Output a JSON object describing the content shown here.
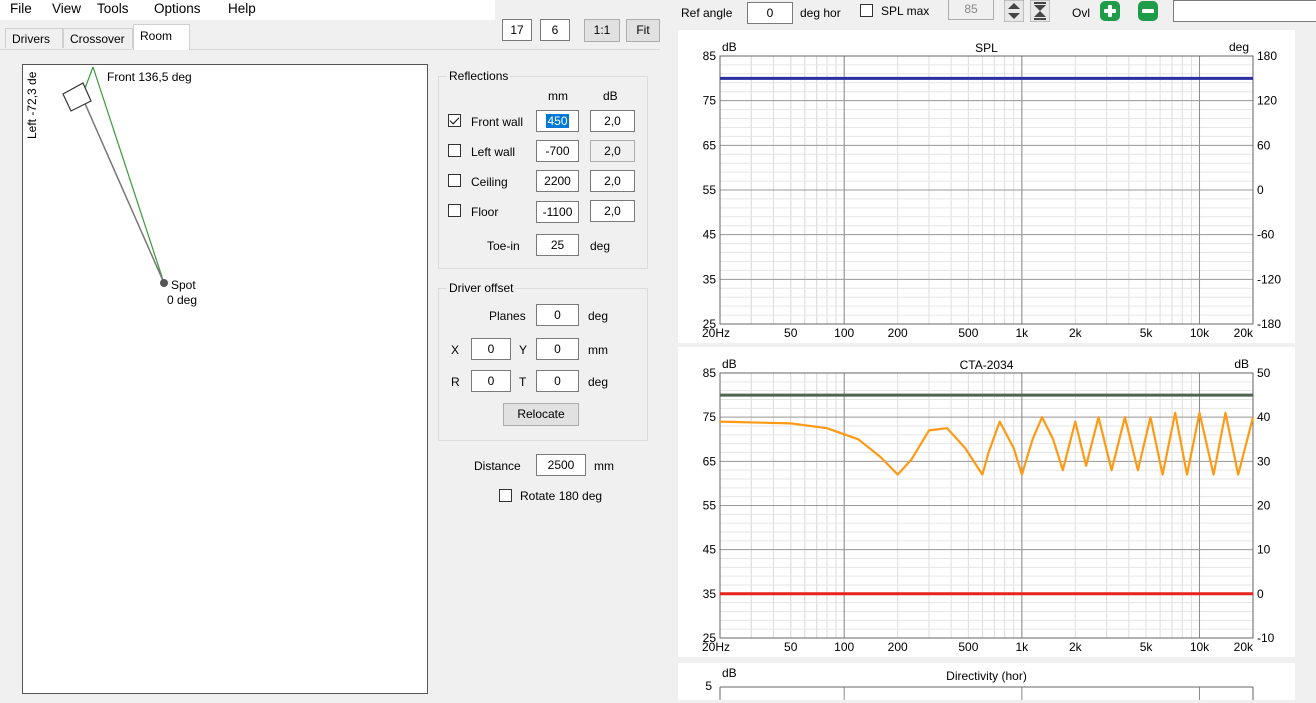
{
  "menu": [
    "File",
    "View",
    "Tools",
    "Options",
    "Help"
  ],
  "toolbar": {
    "num_a": "17",
    "num_b": "6",
    "ratio_label": "1:1",
    "fit_label": "Fit",
    "ref_angle_label": "Ref angle",
    "ref_angle_value": "0",
    "deg_hor_label": "deg hor",
    "spl_max_label": "SPL max",
    "spl_max_value": "85",
    "ovl_label": "Ovl",
    "search_value": ""
  },
  "tabs": {
    "drivers": "Drivers",
    "crossover": "Crossover",
    "room": "Room",
    "active": "room"
  },
  "room": {
    "front_label": "Front 136,5 deg",
    "left_label": "Left -72,3 de",
    "spot_label": "Spot",
    "spot_deg": "0 deg"
  },
  "reflections": {
    "title": "Reflections",
    "col_mm": "mm",
    "col_db": "dB",
    "rows": [
      {
        "label": "Front wall",
        "checked": true,
        "mm": "450",
        "db": "2,0"
      },
      {
        "label": "Left wall",
        "checked": false,
        "mm": "-700",
        "db": "2,0"
      },
      {
        "label": "Ceiling",
        "checked": false,
        "mm": "2200",
        "db": "2,0"
      },
      {
        "label": "Floor",
        "checked": false,
        "mm": "-1100",
        "db": "2,0"
      }
    ],
    "toe_in_label": "Toe-in",
    "toe_in_value": "25",
    "toe_in_unit": "deg"
  },
  "driver_offset": {
    "title": "Driver offset",
    "planes_label": "Planes",
    "planes_value": "0",
    "deg": "deg",
    "x_label": "X",
    "x_value": "0",
    "y_label": "Y",
    "y_value": "0",
    "mm": "mm",
    "r_label": "R",
    "r_value": "0",
    "t_label": "T",
    "t_value": "0",
    "relocate_label": "Relocate"
  },
  "distance": {
    "label": "Distance",
    "value": "2500",
    "unit": "mm"
  },
  "rotate": {
    "label": "Rotate 180 deg",
    "checked": false
  },
  "colors": {
    "spl_line": "#2b2fa0",
    "cta_top": "#4d6650",
    "cta_curve": "#ff9a14",
    "cta_bottom": "#e8221b"
  },
  "chart_data": [
    {
      "type": "line",
      "title": "SPL",
      "ylabel": "dB",
      "y2label": "deg",
      "x_ticks": [
        "20Hz",
        "50",
        "100",
        "200",
        "500",
        "1k",
        "2k",
        "5k",
        "10k",
        "20k"
      ],
      "xlim": [
        20,
        20000
      ],
      "xscale": "log",
      "y_ticks": [
        85,
        75,
        65,
        55,
        45,
        35,
        25
      ],
      "ylim": [
        25,
        85
      ],
      "y2_ticks": [
        180,
        120,
        60,
        0,
        -60,
        -120,
        -180
      ],
      "y2lim": [
        -180,
        180
      ],
      "series": [
        {
          "x": [
            20,
            20000
          ],
          "values": [
            80,
            80
          ]
        }
      ]
    },
    {
      "type": "line",
      "title": "CTA-2034",
      "ylabel": "dB",
      "y2label": "dB",
      "x_ticks": [
        "20Hz",
        "50",
        "100",
        "200",
        "500",
        "1k",
        "2k",
        "5k",
        "10k",
        "20k"
      ],
      "xlim": [
        20,
        20000
      ],
      "xscale": "log",
      "y_ticks": [
        85,
        75,
        65,
        55,
        45,
        35,
        25
      ],
      "ylim": [
        25,
        85
      ],
      "y2_ticks": [
        50,
        40,
        30,
        20,
        10,
        0,
        -10
      ],
      "y2lim": [
        -10,
        50
      ],
      "series": [
        {
          "x": [
            20,
            20000
          ],
          "values": [
            80,
            80
          ]
        },
        {
          "x": [
            20,
            20000
          ],
          "values": [
            35,
            35
          ]
        },
        {
          "x": [
            20,
            50,
            80,
            120,
            160,
            200,
            240,
            300,
            380,
            480,
            600,
            650,
            750,
            900,
            1000,
            1150,
            1300,
            1500,
            1700,
            2000,
            2300,
            2700,
            3200,
            3800,
            4500,
            5300,
            6200,
            7300,
            8500,
            10000,
            12000,
            14000,
            16500,
            20000
          ],
          "values": [
            74,
            73.6,
            72.5,
            70,
            66,
            62,
            65.5,
            72,
            72.5,
            68,
            62,
            67,
            74,
            68,
            62,
            70,
            75,
            70,
            63,
            74,
            64,
            75,
            63,
            75,
            63,
            75,
            62,
            76,
            62,
            76,
            62,
            76,
            62,
            75
          ]
        }
      ]
    },
    {
      "type": "line",
      "title": "Directivity (hor)",
      "ylabel": "dB",
      "y_ticks": [
        5
      ],
      "series": []
    }
  ]
}
